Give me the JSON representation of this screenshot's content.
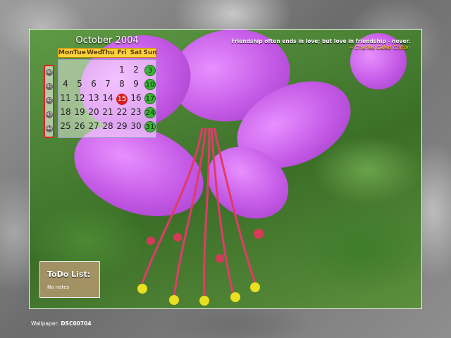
{
  "calendar": {
    "title": "October 2004",
    "weekdays": [
      "Mon",
      "Tue",
      "Wed",
      "Thu",
      "Fri",
      "Sat",
      "Sun"
    ],
    "week_numbers": [
      "40",
      "41",
      "42",
      "43",
      "44"
    ],
    "rows": [
      [
        "",
        "",
        "",
        "",
        "1",
        "2",
        "3"
      ],
      [
        "4",
        "5",
        "6",
        "7",
        "8",
        "9",
        "10"
      ],
      [
        "11",
        "12",
        "13",
        "14",
        "15",
        "16",
        "17"
      ],
      [
        "18",
        "19",
        "20",
        "21",
        "22",
        "23",
        "24"
      ],
      [
        "25",
        "26",
        "27",
        "28",
        "29",
        "30",
        "31"
      ]
    ],
    "today": "15",
    "today_color": "#d81d1d",
    "sunday_color": "#3fb23a",
    "header_color": "#ffd23c"
  },
  "quote": {
    "text": "Friendship often ends in love; but love in friendship - never.",
    "author": "-- Charles Caleb Colton"
  },
  "todo": {
    "title": "ToDo List:",
    "body": "No notes"
  },
  "footer": {
    "label": "Wallpaper:",
    "filename": "DSC00704"
  }
}
